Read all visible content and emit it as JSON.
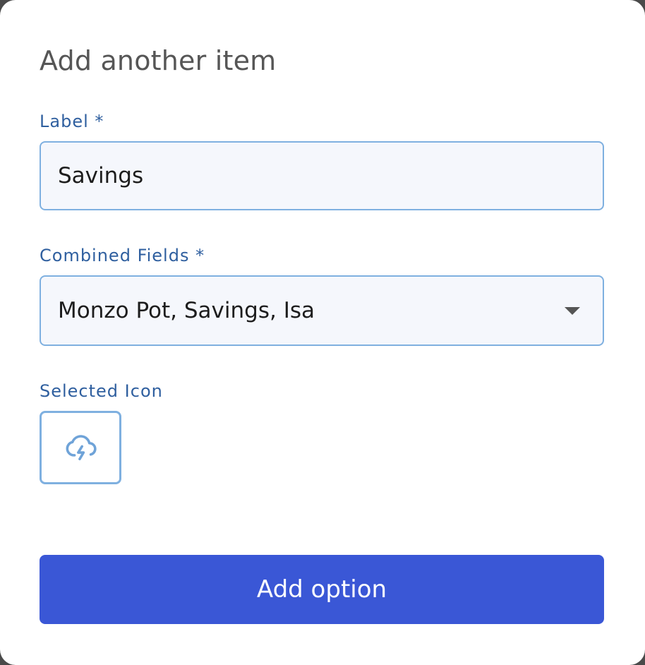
{
  "dialog": {
    "title": "Add another item",
    "label_field": {
      "label": "Label *",
      "value": "Savings"
    },
    "combined_fields": {
      "label": "Combined Fields *",
      "value": "Monzo Pot, Savings, Isa"
    },
    "selected_icon": {
      "label": "Selected Icon",
      "icon": "cloud-lightning-icon"
    },
    "submit_label": "Add option"
  },
  "colors": {
    "accent": "#3a57d6",
    "label": "#2f5f9f",
    "border": "#7fb0e0",
    "input_bg": "#f5f7fc"
  }
}
